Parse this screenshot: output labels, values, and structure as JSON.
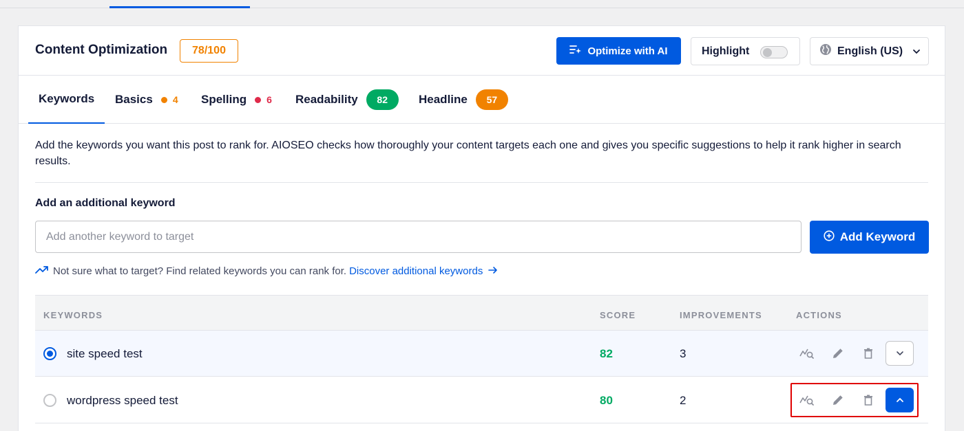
{
  "header": {
    "title": "Content Optimization",
    "score": "78/100",
    "ai_button": "Optimize with AI",
    "highlight_label": "Highlight",
    "language": "English (US)"
  },
  "tabs": [
    {
      "label": "Keywords",
      "active": true
    },
    {
      "label": "Basics",
      "count": "4",
      "status_color": "#f18200"
    },
    {
      "label": "Spelling",
      "count": "6",
      "status_color": "#df2a4a"
    },
    {
      "label": "Readability",
      "badge": "82",
      "badge_color": "#00aa63"
    },
    {
      "label": "Headline",
      "badge": "57",
      "badge_color": "#f18200"
    }
  ],
  "description": "Add the keywords you want this post to rank for. AIOSEO checks how thoroughly your content targets each one and gives you specific suggestions to help it rank higher in search results.",
  "add_keyword": {
    "label": "Add an additional keyword",
    "placeholder": "Add another keyword to target",
    "button": "Add Keyword"
  },
  "discover": {
    "text": "Not sure what to target? Find related keywords you can rank for.",
    "link": "Discover additional keywords"
  },
  "table": {
    "headers": {
      "keywords": "KEYWORDS",
      "score": "SCORE",
      "improvements": "IMPROVEMENTS",
      "actions": "ACTIONS"
    },
    "rows": [
      {
        "keyword": "site speed test",
        "score": "82",
        "improvements": "3",
        "selected": true,
        "expanded": false
      },
      {
        "keyword": "wordpress speed test",
        "score": "80",
        "improvements": "2",
        "selected": false,
        "expanded": true
      }
    ]
  },
  "colors": {
    "primary": "#005ae0",
    "good": "#00aa63",
    "warning": "#f18200",
    "error": "#df2a4a",
    "annotation": "#e00000"
  }
}
